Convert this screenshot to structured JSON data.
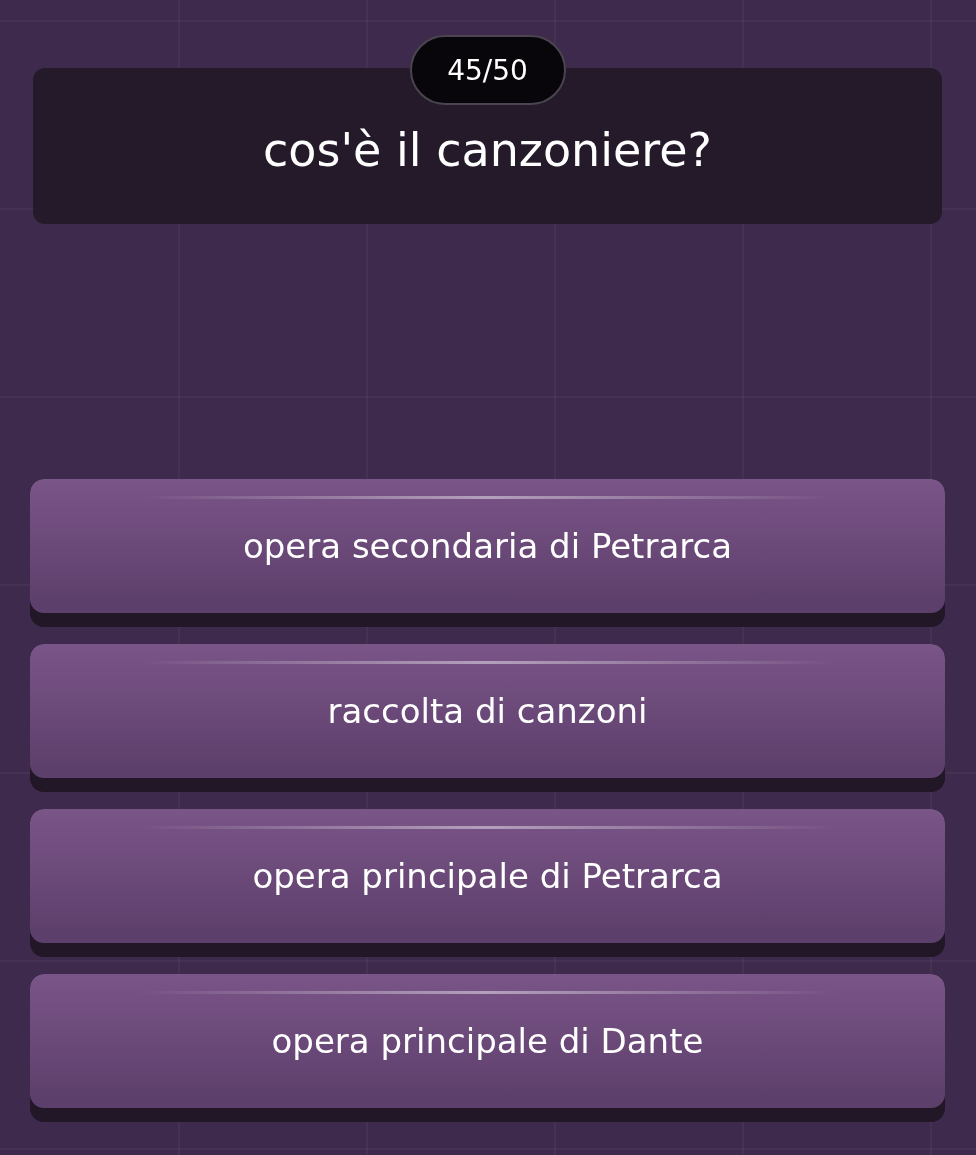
{
  "counter": "45/50",
  "question": "cos'è il canzoniere?",
  "answers": [
    {
      "label": "opera secondaria di Petrarca"
    },
    {
      "label": "raccolta di canzoni"
    },
    {
      "label": "opera principale di Petrarca"
    },
    {
      "label": "opera principale di Dante"
    }
  ]
}
